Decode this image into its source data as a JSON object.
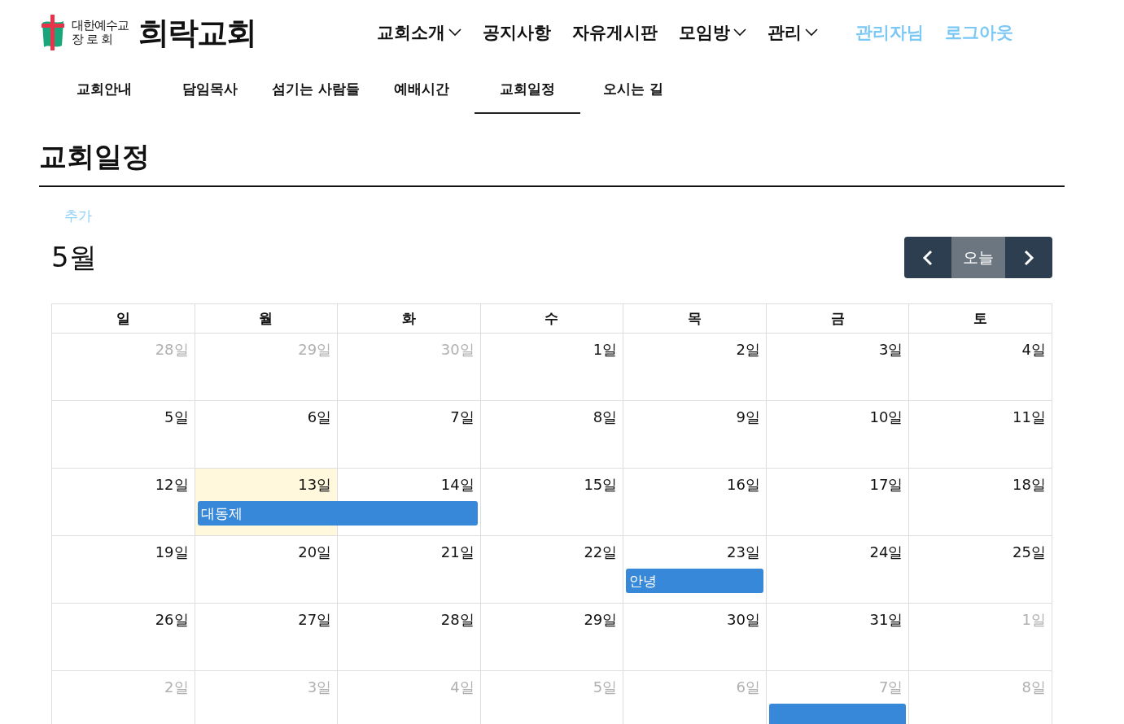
{
  "logo": {
    "denomination_top": "대한예수교",
    "denomination_bottom": "장 로 회",
    "name": "희락교회"
  },
  "nav": [
    {
      "label": "교회소개",
      "dropdown": true
    },
    {
      "label": "공지사항",
      "dropdown": false
    },
    {
      "label": "자유게시판",
      "dropdown": false
    },
    {
      "label": "모임방",
      "dropdown": true
    },
    {
      "label": "관리",
      "dropdown": true
    }
  ],
  "user_links": [
    "관리자님",
    "로그아웃"
  ],
  "subnav": [
    {
      "label": "교회안내",
      "selected": false
    },
    {
      "label": "담임목사",
      "selected": false
    },
    {
      "label": "섬기는 사람들",
      "selected": false
    },
    {
      "label": "예배시간",
      "selected": false
    },
    {
      "label": "교회일정",
      "selected": true
    },
    {
      "label": "오시는 길",
      "selected": false
    }
  ],
  "page_title": "교회일정",
  "add_link": "추가",
  "calendar": {
    "month": "5월",
    "today_button": "오늘",
    "weekdays": [
      "일",
      "월",
      "화",
      "수",
      "목",
      "금",
      "토"
    ],
    "weeks": [
      [
        {
          "date": "28일",
          "muted": true
        },
        {
          "date": "29일",
          "muted": true
        },
        {
          "date": "30일",
          "muted": true
        },
        {
          "date": "1일",
          "muted": false
        },
        {
          "date": "2일",
          "muted": false
        },
        {
          "date": "3일",
          "muted": false
        },
        {
          "date": "4일",
          "muted": false
        }
      ],
      [
        {
          "date": "5일",
          "muted": false
        },
        {
          "date": "6일",
          "muted": false
        },
        {
          "date": "7일",
          "muted": false
        },
        {
          "date": "8일",
          "muted": false
        },
        {
          "date": "9일",
          "muted": false
        },
        {
          "date": "10일",
          "muted": false
        },
        {
          "date": "11일",
          "muted": false
        }
      ],
      [
        {
          "date": "12일",
          "muted": false
        },
        {
          "date": "13일",
          "muted": false,
          "today": true,
          "event": {
            "title": "대동제",
            "continues_left": false,
            "continues_right": true
          }
        },
        {
          "date": "14일",
          "muted": false,
          "event": {
            "continues_left": true,
            "continues_right": false
          }
        },
        {
          "date": "15일",
          "muted": false
        },
        {
          "date": "16일",
          "muted": false
        },
        {
          "date": "17일",
          "muted": false
        },
        {
          "date": "18일",
          "muted": false
        }
      ],
      [
        {
          "date": "19일",
          "muted": false
        },
        {
          "date": "20일",
          "muted": false
        },
        {
          "date": "21일",
          "muted": false
        },
        {
          "date": "22일",
          "muted": false
        },
        {
          "date": "23일",
          "muted": false,
          "event": {
            "title": "안녕",
            "continues_left": false,
            "continues_right": false
          }
        },
        {
          "date": "24일",
          "muted": false
        },
        {
          "date": "25일",
          "muted": false
        }
      ],
      [
        {
          "date": "26일",
          "muted": false
        },
        {
          "date": "27일",
          "muted": false
        },
        {
          "date": "28일",
          "muted": false
        },
        {
          "date": "29일",
          "muted": false
        },
        {
          "date": "30일",
          "muted": false
        },
        {
          "date": "31일",
          "muted": false
        },
        {
          "date": "1일",
          "muted": true
        }
      ],
      [
        {
          "date": "2일",
          "muted": true
        },
        {
          "date": "3일",
          "muted": true
        },
        {
          "date": "4일",
          "muted": true
        },
        {
          "date": "5일",
          "muted": true
        },
        {
          "date": "6일",
          "muted": true
        },
        {
          "date": "7일",
          "muted": true,
          "event": {
            "continues_left": false,
            "continues_right": false
          }
        },
        {
          "date": "8일",
          "muted": true
        }
      ]
    ]
  }
}
